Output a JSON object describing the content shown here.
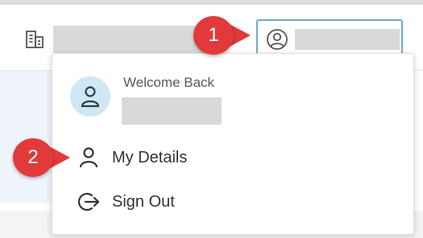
{
  "header": {
    "org_icon": "building-icon",
    "account_icon": "user-circle-icon"
  },
  "dropdown": {
    "avatar_icon": "user-icon",
    "welcome": "Welcome Back",
    "items": [
      {
        "label": "My Details",
        "icon": "user-icon"
      },
      {
        "label": "Sign Out",
        "icon": "sign-out-icon"
      }
    ]
  },
  "annotations": {
    "step1": "1",
    "step2": "2"
  },
  "colors": {
    "highlight_border": "#6fa8d6",
    "badge": "#e23a3a",
    "avatar_bg": "#cfe8f3",
    "redaction": "#d9d9d9"
  }
}
